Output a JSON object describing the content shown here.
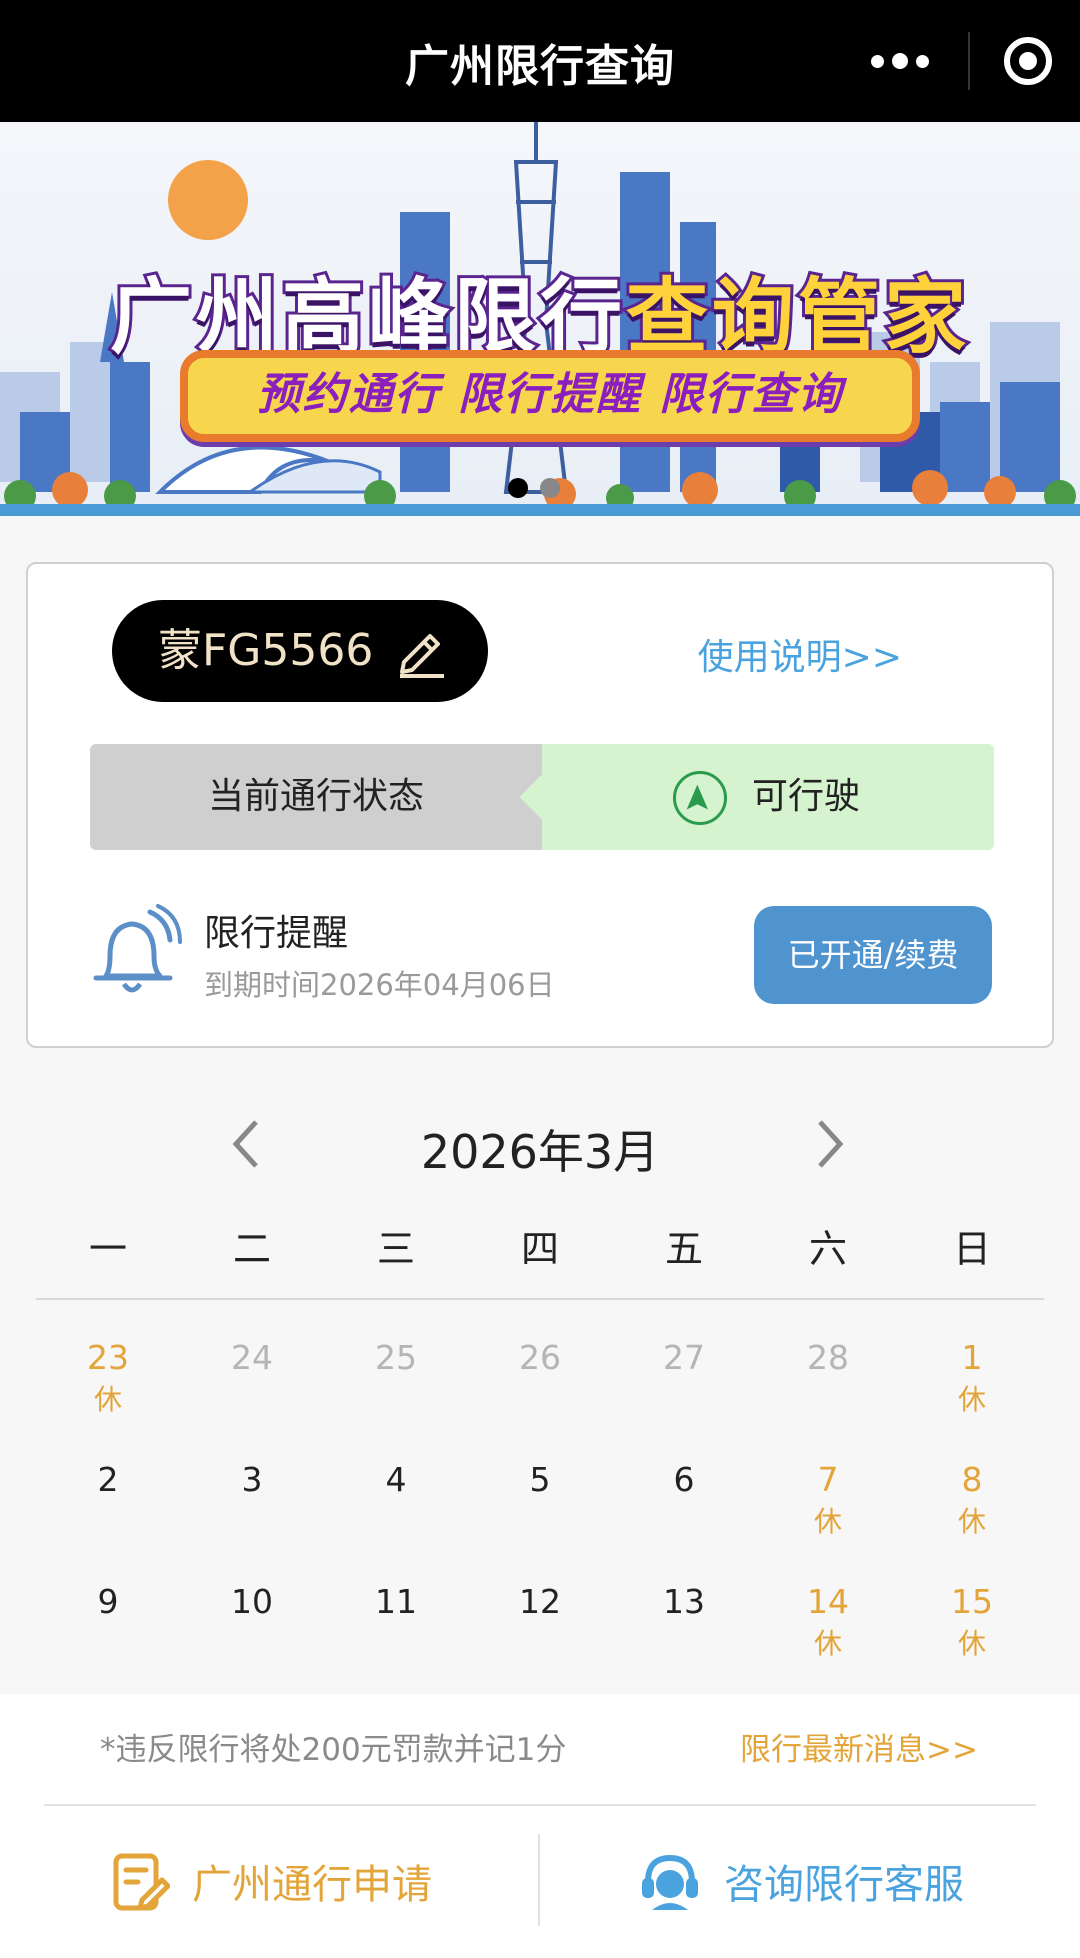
{
  "titlebar": {
    "title": "广州限行查询",
    "more_icon": "more-dots-icon",
    "close_icon": "target-circle-icon"
  },
  "banner": {
    "title_part1": "广州高峰限行",
    "title_part2": "查询管家",
    "tagline": "预约通行  限行提醒  限行查询",
    "pager": {
      "count": 2,
      "active": 1
    }
  },
  "card": {
    "plate": "蒙FG5566",
    "help_link": "使用说明>>",
    "status_label": "当前通行状态",
    "status_value": "可行驶",
    "reminder_title": "限行提醒",
    "reminder_expiry": "到期时间2026年04月06日",
    "renew_button": "已开通/续费"
  },
  "calendar": {
    "month_label": "2026年3月",
    "weekdays": [
      "一",
      "二",
      "三",
      "四",
      "五",
      "六",
      "日"
    ],
    "rows": [
      [
        {
          "d": "23",
          "tag": "休",
          "type": "holiday"
        },
        {
          "d": "24",
          "tag": "",
          "type": "muted"
        },
        {
          "d": "25",
          "tag": "",
          "type": "muted"
        },
        {
          "d": "26",
          "tag": "",
          "type": "muted"
        },
        {
          "d": "27",
          "tag": "",
          "type": "muted"
        },
        {
          "d": "28",
          "tag": "",
          "type": "muted"
        },
        {
          "d": "1",
          "tag": "休",
          "type": "holiday"
        }
      ],
      [
        {
          "d": "2",
          "tag": "",
          "type": "normal"
        },
        {
          "d": "3",
          "tag": "",
          "type": "normal"
        },
        {
          "d": "4",
          "tag": "",
          "type": "normal"
        },
        {
          "d": "5",
          "tag": "",
          "type": "normal"
        },
        {
          "d": "6",
          "tag": "",
          "type": "normal"
        },
        {
          "d": "7",
          "tag": "休",
          "type": "holiday"
        },
        {
          "d": "8",
          "tag": "休",
          "type": "holiday"
        }
      ],
      [
        {
          "d": "9",
          "tag": "",
          "type": "normal"
        },
        {
          "d": "10",
          "tag": "",
          "type": "normal"
        },
        {
          "d": "11",
          "tag": "",
          "type": "normal"
        },
        {
          "d": "12",
          "tag": "",
          "type": "normal"
        },
        {
          "d": "13",
          "tag": "",
          "type": "normal"
        },
        {
          "d": "14",
          "tag": "休",
          "type": "holiday"
        },
        {
          "d": "15",
          "tag": "休",
          "type": "holiday"
        }
      ]
    ]
  },
  "footer": {
    "fine_notice": "*违反限行将处200元罚款并记1分",
    "news_link": "限行最新消息>>",
    "apply_label": "广州通行申请",
    "service_label": "咨询限行客服"
  },
  "colors": {
    "accent_orange": "#e3a53a",
    "accent_blue": "#4aa3de",
    "button_blue": "#4f93cf",
    "status_green": "#d6f3cf"
  }
}
